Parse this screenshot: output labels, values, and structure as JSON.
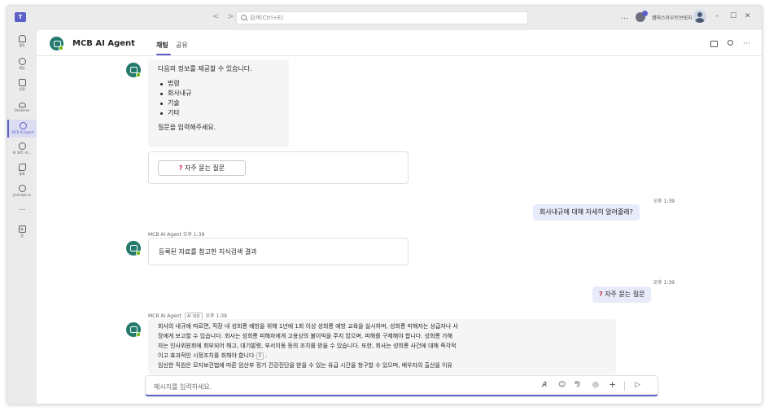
{
  "titlebar": {
    "search_placeholder": "검색(Ctrl+E)",
    "org_name": "캠퍼스아우트브릿지",
    "more": "…",
    "back": "<",
    "forward": ">",
    "minimize": "–",
    "maximize": "☐",
    "close": "✕"
  },
  "rail": {
    "items": [
      {
        "label": "활동",
        "icon": "bell-icon"
      },
      {
        "label": "채팅",
        "icon": "chat-icon"
      },
      {
        "label": "일정",
        "icon": "calendar-icon"
      },
      {
        "label": "OneDrive",
        "icon": "cloud-icon"
      },
      {
        "label": "MCB AI Agent",
        "icon": "agent-icon"
      },
      {
        "label": "AI 365 ·라...",
        "icon": "agent-icon"
      },
      {
        "label": "통화",
        "icon": "phone-icon"
      },
      {
        "label": "jiverstpl.co",
        "icon": "app-icon"
      },
      {
        "label": "…",
        "icon": "more-icon"
      },
      {
        "label": "앱",
        "icon": "plus-icon"
      }
    ]
  },
  "header": {
    "agent_name": "MCB AI Agent",
    "tabs": [
      {
        "label": "채팅",
        "active": true
      },
      {
        "label": "공유",
        "active": false
      }
    ],
    "more": "···"
  },
  "messages": {
    "first_intro": "다음의 정보를 제공할 수 있습니다.",
    "first_list": [
      "법령",
      "회사내규",
      "기술",
      "기타"
    ],
    "first_prompt": "질문을 입력해주세요.",
    "faq_button": "자주 묻는 질문",
    "faq_mark": "?",
    "user1_time": "오후 1:39",
    "user1_text": "회사내규에 대해 자세히 알려줄래?",
    "bot2_meta": "MCB AI Agent  오후 1:39",
    "bot2_text": "등록된 자료를 참고한 지식검색 결과",
    "user2_time": "오후 1:39",
    "user2_text": "자주 묻는 질문",
    "bot3_meta_name": "MCB AI Agent",
    "bot3_ai_tag": "AI 생성",
    "bot3_meta_time": "오후 1:39",
    "bot3_lines": [
      "회사의 내규에 따르면, 직장 내 성희롱 예방을 위해 1년에 1회 이상 성희롱 예방 교육을 실시하며, 성희롱 피해자는 상급자나 사",
      "장에게 보고할 수 있습니다. 회사는 성희롱 피해자에게 고용상의 불이익을 주지 않으며, 피해를 구제해야 합니다. 성희롱 가해",
      "자는 인사위원회에 회부되어 해고, 대기발령, 부서이동 등의 조치를 받을 수 있습니다. 또한, 회사는 성희롱 사건에 대해 즉각적",
      "이고 효과적인 시정조치를 취해야 합니다"
    ],
    "bot3_ref": "1",
    "bot3_line5": "임신한 직원은 모자보건법에 따른 임산부 정기 건강진단을 받을 수 있는 유급 시간을 청구할 수 있으며, 배우자의 출산을 이유"
  },
  "compose": {
    "placeholder": "메시지를 입력하세요."
  },
  "colors": {
    "brand": "#5b5fc7",
    "agent_icon": "#237a6d",
    "presence": "#6bb700",
    "user_bubble": "#e8ebfa"
  }
}
